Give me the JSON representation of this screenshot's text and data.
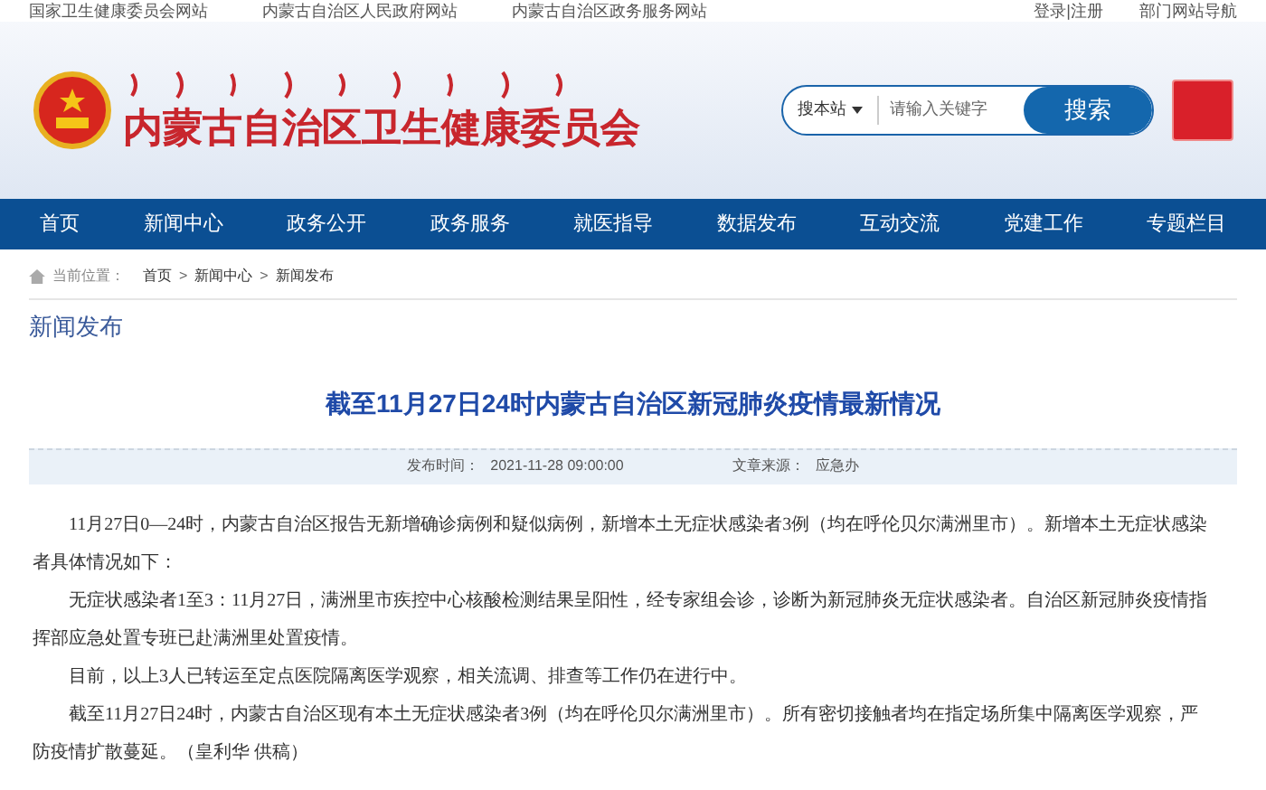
{
  "top_links": [
    "国家卫生健康委员会网站",
    "内蒙古自治区人民政府网站",
    "内蒙古自治区政务服务网站"
  ],
  "top_right": [
    "登录|注册",
    "部门网站导航"
  ],
  "site_title": "内蒙古自治区卫生健康委员会",
  "search": {
    "scope": "搜本站",
    "placeholder": "请输入关键字",
    "button": "搜索"
  },
  "nav": [
    {
      "label": "首页",
      "selected": false
    },
    {
      "label": "新闻中心",
      "selected": false
    },
    {
      "label": "政务公开",
      "selected": false
    },
    {
      "label": "政务服务",
      "selected": false
    },
    {
      "label": "就医指导",
      "selected": false
    },
    {
      "label": "数据发布",
      "selected": false
    },
    {
      "label": "互动交流",
      "selected": false
    },
    {
      "label": "党建工作",
      "selected": false
    },
    {
      "label": "专题栏目",
      "selected": false
    }
  ],
  "breadcrumb": {
    "label": "当前位置：",
    "separator": ">",
    "items": [
      "首页",
      "新闻中心",
      "新闻发布"
    ]
  },
  "section_title": "新闻发布",
  "article": {
    "title": "截至11月27日24时内蒙古自治区新冠肺炎疫情最新情况",
    "meta": [
      {
        "label": "发布时间：",
        "value": "2021-11-28 09:00:00"
      },
      {
        "label": "文章来源：",
        "value": "应急办"
      }
    ],
    "paragraphs": [
      "11月27日0—24时，内蒙古自治区报告无新增确诊病例和疑似病例，新增本土无症状感染者3例（均在呼伦贝尔满洲里市）。新增本土无症状感染者具体情况如下：",
      "无症状感染者1至3：11月27日，满洲里市疾控中心核酸检测结果呈阳性，经专家组会诊，诊断为新冠肺炎无症状感染者。自治区新冠肺炎疫情指挥部应急处置专班已赴满洲里处置疫情。",
      "目前，以上3人已转运至定点医院隔离医学观察，相关流调、排查等工作仍在进行中。",
      "截至11月27日24时，内蒙古自治区现有本土无症状感染者3例（均在呼伦贝尔满洲里市）。所有密切接触者均在指定场所集中隔离医学观察，严防疫情扩散蔓延。（皇利华 供稿）"
    ]
  }
}
